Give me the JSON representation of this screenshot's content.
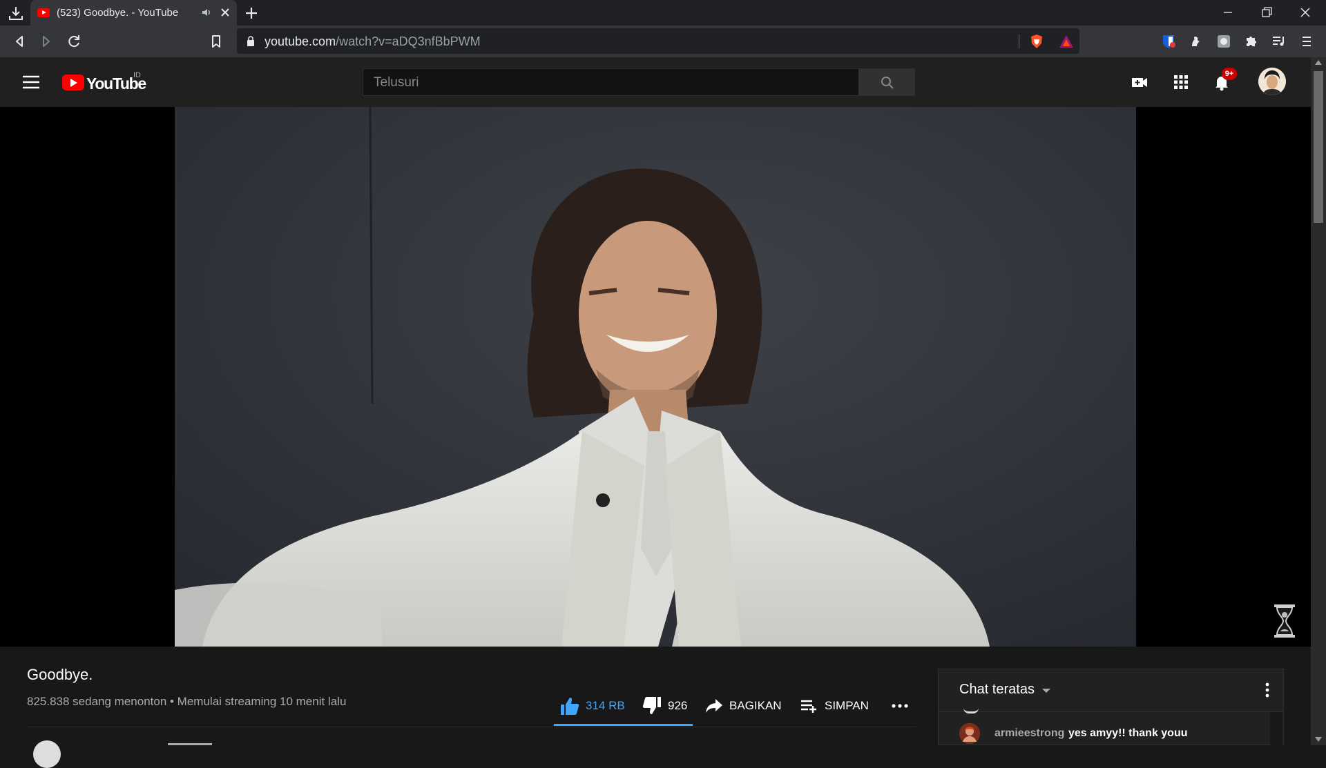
{
  "browser": {
    "tab": {
      "title": "(523) Goodbye. - YouTube",
      "favicon": "youtube-favicon",
      "audio_icon": "speaker-icon"
    },
    "address": {
      "host": "youtube.com",
      "path": "/watch?v=aDQ3nfBbPWM"
    },
    "accent": "#3ea6ff"
  },
  "youtube": {
    "logo_text": "YouTube",
    "country_code": "ID",
    "search": {
      "placeholder": "Telusuri"
    },
    "notification_count": "9+"
  },
  "video": {
    "title": "Goodbye.",
    "meta": "825.838 sedang menonton • Memulai streaming 10 menit lalu",
    "actions": {
      "like_count": "314 RB",
      "dislike_count": "926",
      "share_label": "BAGIKAN",
      "save_label": "SIMPAN"
    }
  },
  "chat": {
    "title": "Chat teratas",
    "messages": [
      {
        "author": "armieestrong",
        "text": "yes amyy!! thank youu"
      }
    ]
  }
}
